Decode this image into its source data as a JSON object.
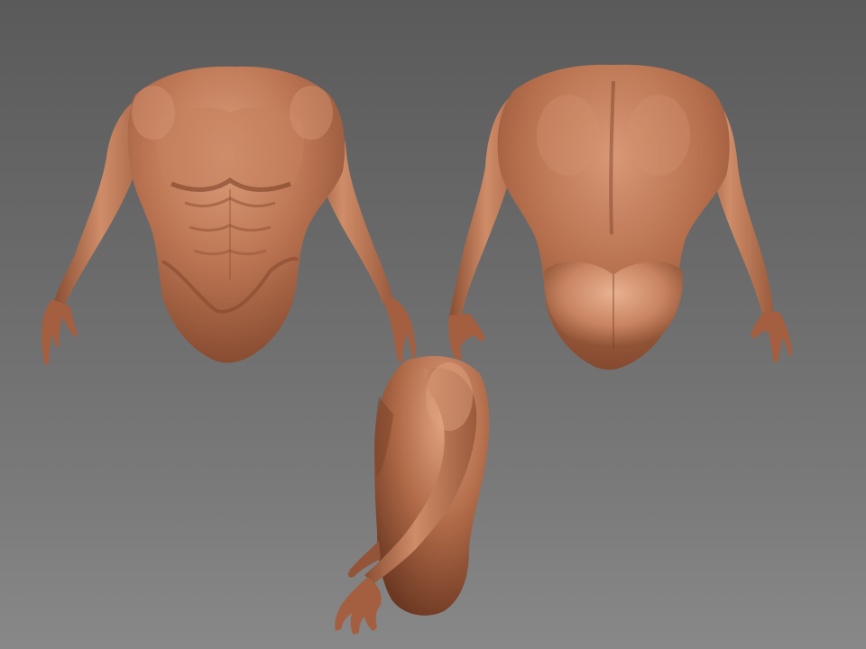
{
  "scene": {
    "background_top": "#5a5a5a",
    "background_bottom": "#888888",
    "skin_base": "#b36b4a",
    "skin_highlight": "#e4a886",
    "skin_shadow": "#6e3a24",
    "views": [
      {
        "name": "front"
      },
      {
        "name": "back"
      },
      {
        "name": "side"
      }
    ]
  }
}
